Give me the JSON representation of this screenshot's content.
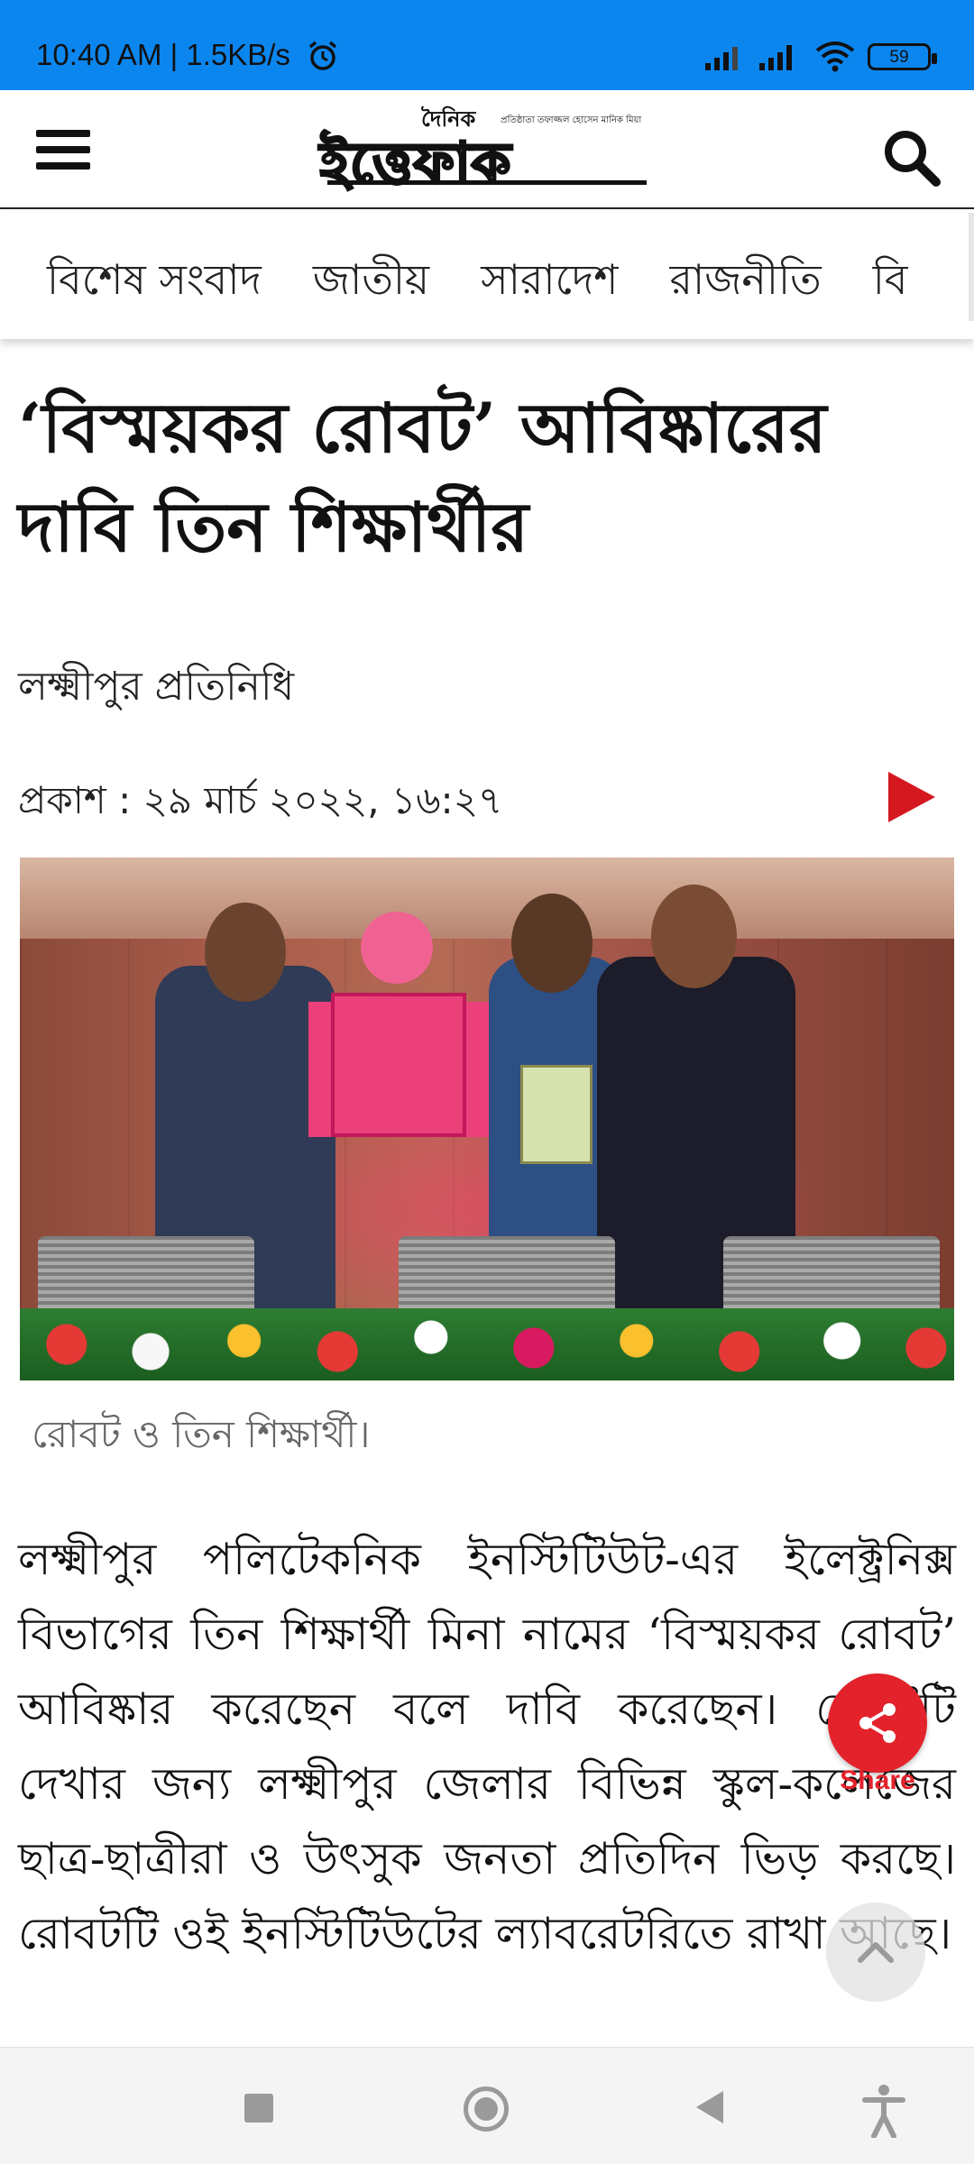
{
  "status_bar": {
    "time_speed": "10:40 AM | 1.5KB/s",
    "battery": "59",
    "accent": "#0c86ef"
  },
  "header": {
    "logo_small": "দৈনিক",
    "logo_main": "ইত্তেফাক",
    "logo_tagline": "প্রতিষ্ঠাতা তফাজ্জল হোসেন মানিক মিয়া",
    "menu_icon": "hamburger-menu-icon",
    "search_icon": "search-icon"
  },
  "categories": [
    "বিশেষ সংবাদ",
    "জাতীয়",
    "সারাদেশ",
    "রাজনীতি",
    "বি"
  ],
  "article": {
    "headline": "‘বিস্ময়কর রোবট’ আবিষ্কারের দাবি তিন শিক্ষার্থীর",
    "reporter": "লক্ষ্মীপুর প্রতিনিধি",
    "published": "প্রকাশ : ২৯ মার্চ ২০২২, ১৬:২৭",
    "image_caption": "রোবট ও তিন শিক্ষার্থী।",
    "body": "লক্ষ্মীপুর পলিটেকনিক ইনস্টিটিউট-এর ইলেক্ট্রনিক্স বিভাগের তিন শিক্ষার্থী মিনা নামের ‘বিস্ময়কর রোবট’ আবিষ্কার করেছেন বলে দাবি করেছেন। রোবটটি দেখার জন্য লক্ষ্মীপুর জেলার বিভিন্ন স্কুল-কলেজের ছাত্র-ছাত্রীরা ও উৎসুক জনতা প্রতিদিন ভিড় করছে। রোবটটি ওই ইনস্টিটিউটের ল্যাবরেটরিতে রাখা আছে।",
    "play_color": "#d51820"
  },
  "fab": {
    "share_label": "Share",
    "share_color": "#e3222b"
  },
  "navbar": {
    "recent_icon": "recent-apps-icon",
    "home_icon": "home-icon",
    "back_icon": "back-icon",
    "accessibility_icon": "accessibility-icon"
  }
}
